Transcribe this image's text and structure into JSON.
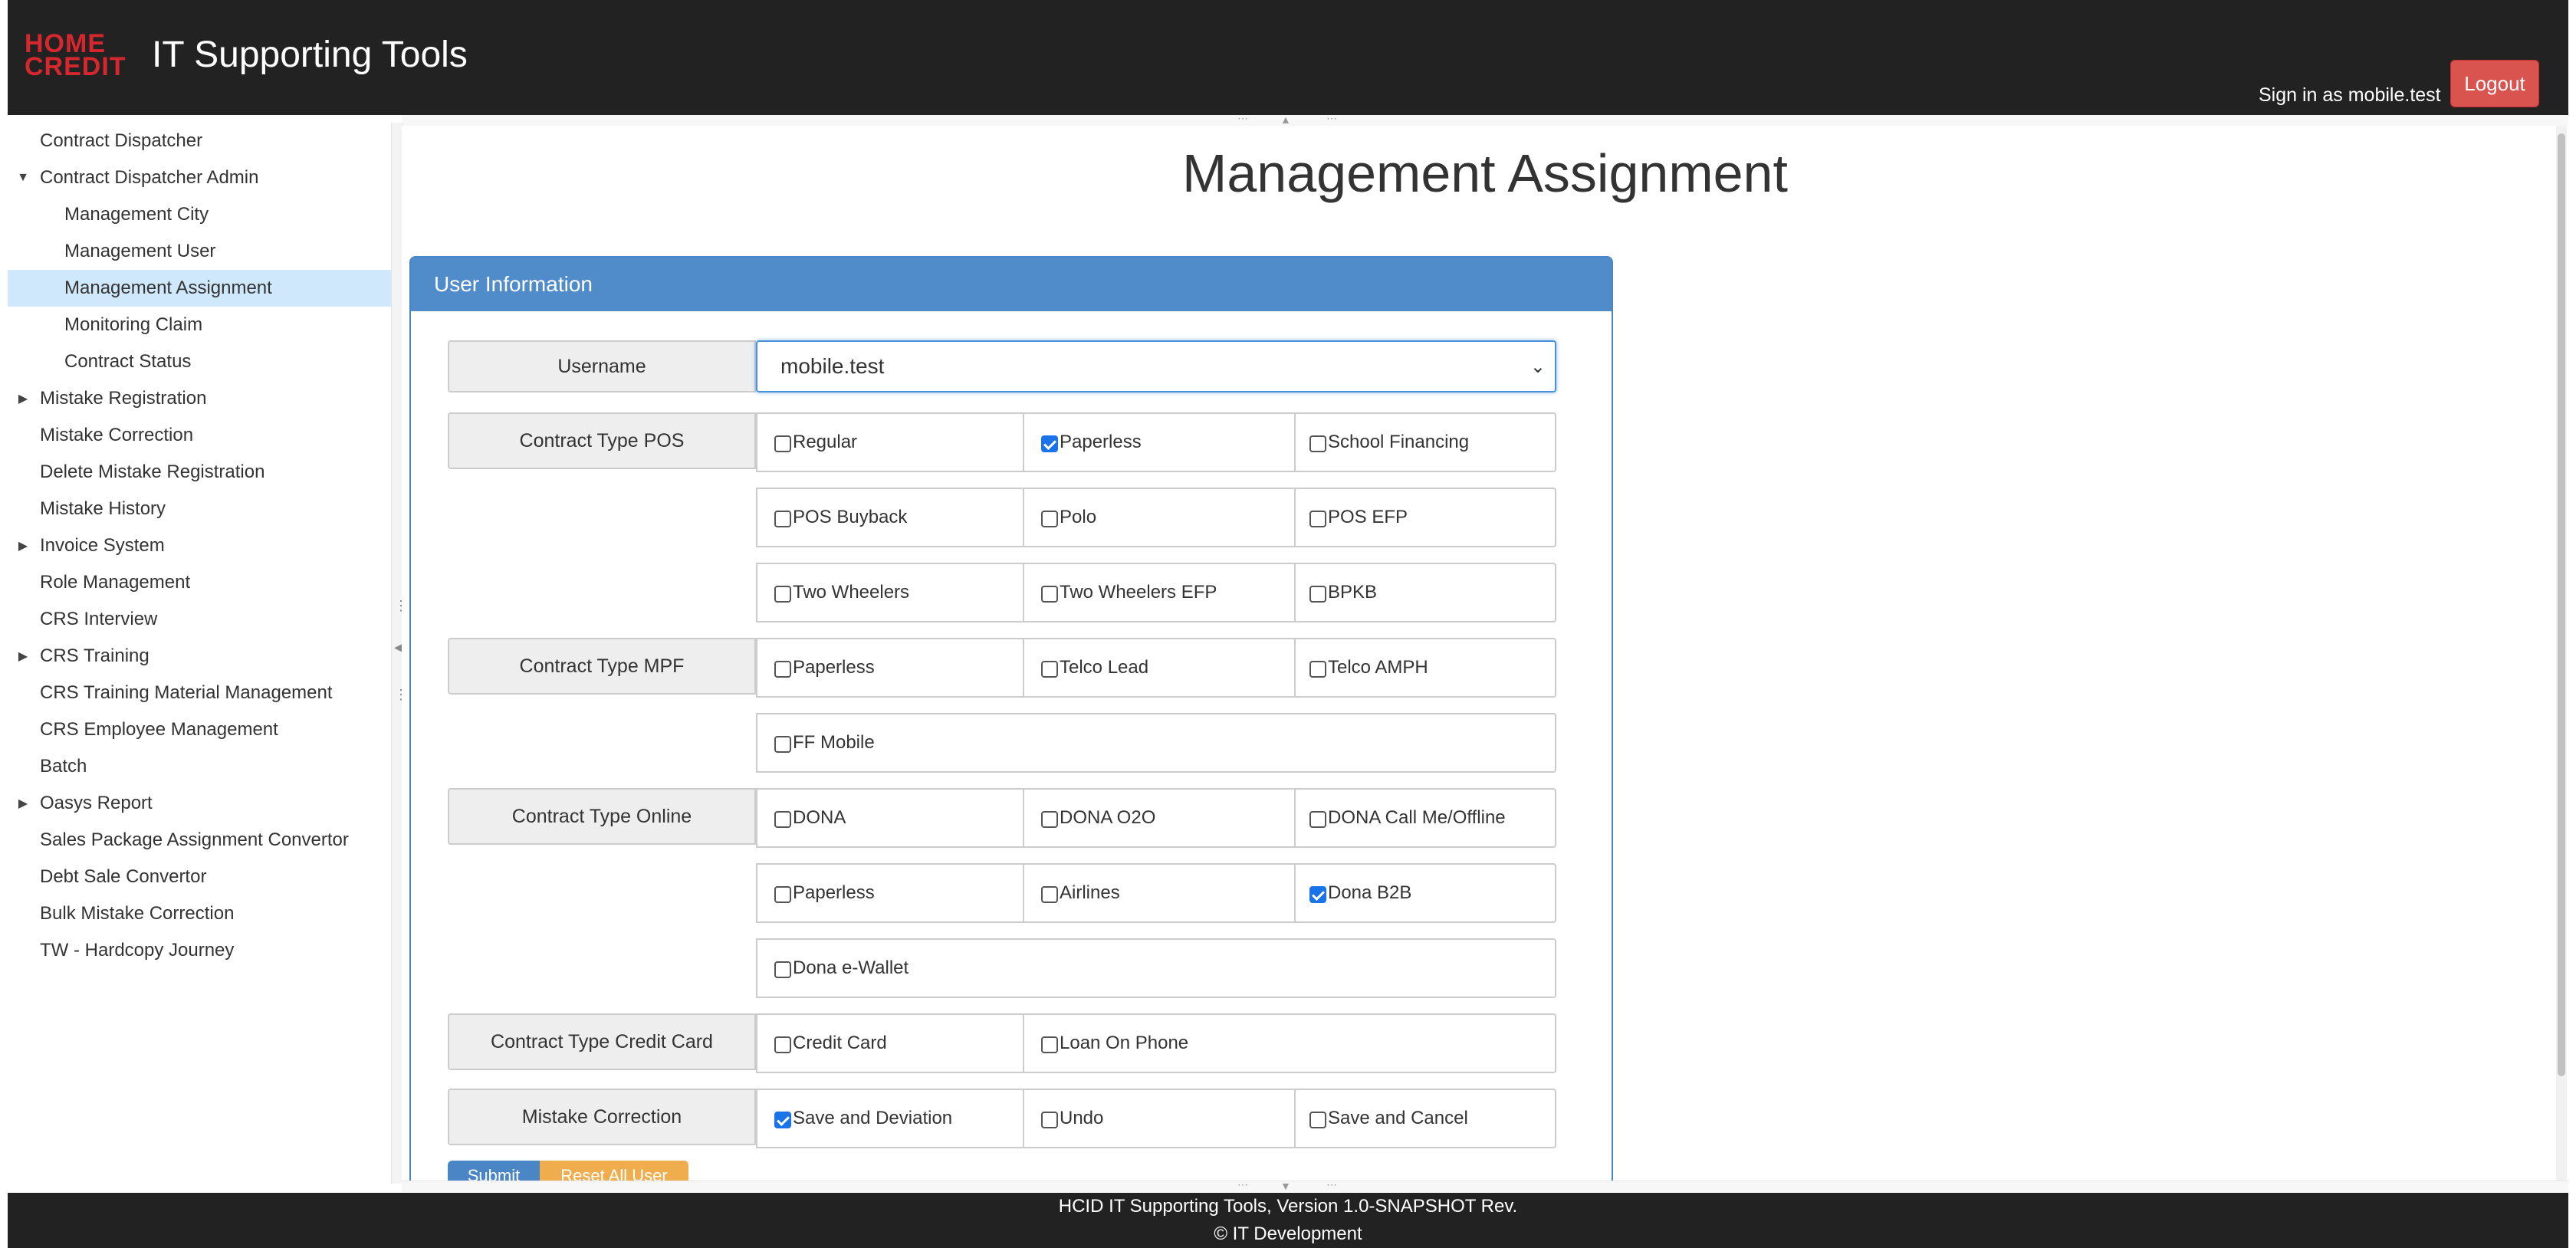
{
  "header": {
    "logo_line1": "HOME",
    "logo_line2": "CREDIT",
    "title": "IT Supporting Tools",
    "signin": "Sign in as mobile.test",
    "logout": "Logout"
  },
  "sidebar": {
    "items": [
      {
        "label": "Contract Dispatcher",
        "indent": 0,
        "arrow": ""
      },
      {
        "label": "Contract Dispatcher Admin",
        "indent": 0,
        "arrow": "expanded"
      },
      {
        "label": "Management City",
        "indent": 1,
        "arrow": ""
      },
      {
        "label": "Management User",
        "indent": 1,
        "arrow": ""
      },
      {
        "label": "Management Assignment",
        "indent": 1,
        "arrow": "",
        "selected": true
      },
      {
        "label": "Monitoring Claim",
        "indent": 1,
        "arrow": ""
      },
      {
        "label": "Contract Status",
        "indent": 1,
        "arrow": ""
      },
      {
        "label": "Mistake Registration",
        "indent": 0,
        "arrow": "collapsed"
      },
      {
        "label": "Mistake Correction",
        "indent": 0,
        "arrow": ""
      },
      {
        "label": "Delete Mistake Registration",
        "indent": 0,
        "arrow": ""
      },
      {
        "label": "Mistake History",
        "indent": 0,
        "arrow": ""
      },
      {
        "label": "Invoice System",
        "indent": 0,
        "arrow": "collapsed"
      },
      {
        "label": "Role Management",
        "indent": 0,
        "arrow": ""
      },
      {
        "label": "CRS Interview",
        "indent": 0,
        "arrow": ""
      },
      {
        "label": "CRS Training",
        "indent": 0,
        "arrow": "collapsed"
      },
      {
        "label": "CRS Training Material Management",
        "indent": 0,
        "arrow": ""
      },
      {
        "label": "CRS Employee Management",
        "indent": 0,
        "arrow": ""
      },
      {
        "label": "Batch",
        "indent": 0,
        "arrow": ""
      },
      {
        "label": "Oasys Report",
        "indent": 0,
        "arrow": "collapsed"
      },
      {
        "label": "Sales Package Assignment Convertor",
        "indent": 0,
        "arrow": ""
      },
      {
        "label": "Debt Sale Convertor",
        "indent": 0,
        "arrow": ""
      },
      {
        "label": "Bulk Mistake Correction",
        "indent": 0,
        "arrow": ""
      },
      {
        "label": "TW - Hardcopy Journey",
        "indent": 0,
        "arrow": ""
      }
    ]
  },
  "main": {
    "title": "Management Assignment",
    "panel_title": "User Information",
    "username_label": "Username",
    "username_value": "mobile.test",
    "groups": [
      {
        "label": "Contract Type POS",
        "rows": [
          [
            {
              "label": "Regular",
              "checked": false
            },
            {
              "label": "Paperless",
              "checked": true
            },
            {
              "label": "School Financing",
              "checked": false
            }
          ],
          [
            {
              "label": "POS Buyback",
              "checked": false
            },
            {
              "label": "Polo",
              "checked": false
            },
            {
              "label": "POS EFP",
              "checked": false
            }
          ],
          [
            {
              "label": "Two Wheelers",
              "checked": false
            },
            {
              "label": "Two Wheelers EFP",
              "checked": false
            },
            {
              "label": "BPKB",
              "checked": false
            }
          ]
        ]
      },
      {
        "label": "Contract Type MPF",
        "rows": [
          [
            {
              "label": "Paperless",
              "checked": false
            },
            {
              "label": "Telco Lead",
              "checked": false
            },
            {
              "label": "Telco AMPH",
              "checked": false
            }
          ],
          [
            {
              "label": "FF Mobile",
              "checked": false
            }
          ]
        ]
      },
      {
        "label": "Contract Type Online",
        "rows": [
          [
            {
              "label": "DONA",
              "checked": false
            },
            {
              "label": "DONA O2O",
              "checked": false
            },
            {
              "label": "DONA Call Me/Offline",
              "checked": false
            }
          ],
          [
            {
              "label": "Paperless",
              "checked": false
            },
            {
              "label": "Airlines",
              "checked": false
            },
            {
              "label": "Dona B2B",
              "checked": true
            }
          ],
          [
            {
              "label": "Dona e-Wallet",
              "checked": false
            }
          ]
        ]
      },
      {
        "label": "Contract Type Credit Card",
        "rows": [
          [
            {
              "label": "Credit Card",
              "checked": false
            },
            {
              "label": "Loan On Phone",
              "checked": false
            }
          ]
        ]
      },
      {
        "label": "Mistake Correction",
        "rows": [
          [
            {
              "label": "Save and Deviation",
              "checked": true
            },
            {
              "label": "Undo",
              "checked": false
            },
            {
              "label": "Save and Cancel",
              "checked": false
            }
          ]
        ]
      }
    ],
    "submit": "Submit",
    "reset": "Reset All User"
  },
  "footer": {
    "line1": "HCID IT Supporting Tools, Version 1.0-SNAPSHOT Rev.",
    "line2": "© IT Development"
  },
  "colors": {
    "header_bg": "#222222",
    "brand_red": "#d6262e",
    "panel_blue": "#508bca",
    "logout_red": "#d9534f",
    "submit_blue": "#4a86c5",
    "reset_orange": "#f0ad4e",
    "selected_bg": "#cfe8fb"
  }
}
